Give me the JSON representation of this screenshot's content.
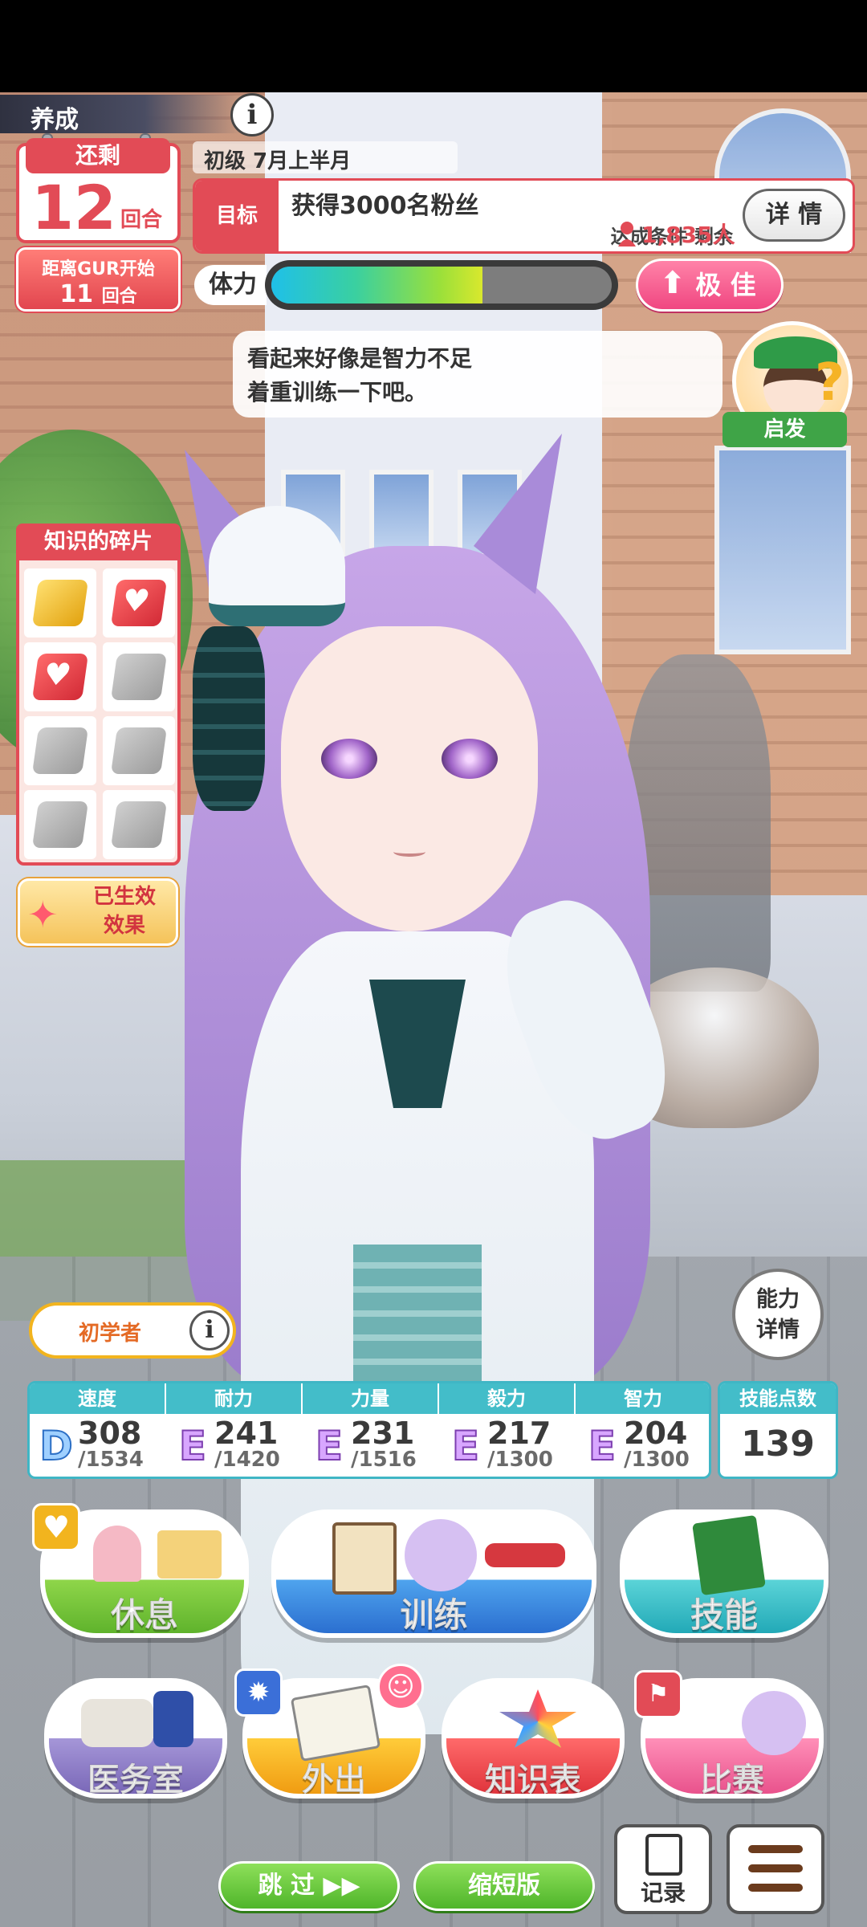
{
  "header": {
    "mode_label": "养成",
    "info_icon": "i"
  },
  "turns": {
    "title": "还剩",
    "count": "12",
    "unit": "回合"
  },
  "gur": {
    "title": "距离GUR开始",
    "count": "11",
    "unit": "回合"
  },
  "date": "初级  7月上半月",
  "goal": {
    "tag": "目标",
    "text": "获得3000名粉丝",
    "condition": "达成条件 剩余",
    "remaining": "1,835人",
    "detail_label": "详 情"
  },
  "stamina": {
    "label": "体力",
    "fill_percent": 62
  },
  "mood": {
    "arrow": "⬆",
    "label": "极 佳"
  },
  "dialog": {
    "line1": "看起来好像是智力不足",
    "line2": "着重训练一下吧。"
  },
  "advisor": {
    "label": "启发",
    "q": "?"
  },
  "fragments": {
    "title": "知识的碎片",
    "slots": [
      "gold",
      "heart",
      "heart",
      "empty",
      "empty",
      "empty",
      "empty",
      "empty"
    ]
  },
  "effect": {
    "line1": "已生效",
    "line2": "效果"
  },
  "rank_title": {
    "label": "初学者",
    "info": "i"
  },
  "stat_detail": {
    "line1": "能力",
    "line2": "详情"
  },
  "stats": [
    {
      "name": "速度",
      "icon": "shoe-icon",
      "grade": "D",
      "value": "308",
      "max": "/1534"
    },
    {
      "name": "耐力",
      "icon": "heart-icon",
      "grade": "E",
      "value": "241",
      "max": "/1420"
    },
    {
      "name": "力量",
      "icon": "arm-icon",
      "grade": "E",
      "value": "231",
      "max": "/1516"
    },
    {
      "name": "毅力",
      "icon": "flame-icon",
      "grade": "E",
      "value": "217",
      "max": "/1300"
    },
    {
      "name": "智力",
      "icon": "mortarboard-icon",
      "grade": "E",
      "value": "204",
      "max": "/1300"
    }
  ],
  "skill_points": {
    "label": "技能点数",
    "value": "139"
  },
  "actions": {
    "rest": "休息",
    "train": "训练",
    "skill": "技能",
    "infirmary": "医务室",
    "outing": "外出",
    "knowledge": "知识表",
    "race": "比赛"
  },
  "footer": {
    "skip": "跳 过  ▶▶",
    "short": "缩短版",
    "log": "记录"
  },
  "colors": {
    "accent_red": "#e24b56",
    "stat_teal": "#43bdc9",
    "green_btn": "#4fb52a",
    "pink_btn": "#f04781"
  }
}
